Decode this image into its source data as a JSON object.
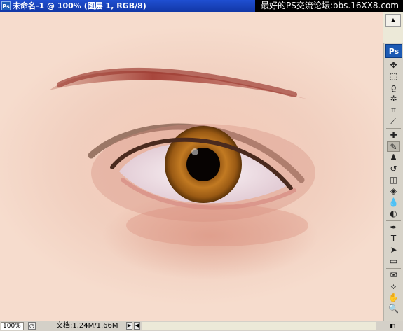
{
  "window": {
    "app_icon_label": "Ps",
    "title": "未命名-1 @ 100% (图层 1, RGB/8)",
    "watermark": "最好的PS交流论坛:bbs.16XX8.com"
  },
  "toolbox": {
    "logo": "Ps",
    "tools": [
      {
        "name": "move-tool",
        "glyph": "✥"
      },
      {
        "name": "marquee-tool",
        "glyph": "⬚"
      },
      {
        "name": "lasso-tool",
        "glyph": "ϱ"
      },
      {
        "name": "magic-wand-tool",
        "glyph": "✲"
      },
      {
        "name": "crop-tool",
        "glyph": "⌗"
      },
      {
        "name": "slice-tool",
        "glyph": "⟋"
      },
      {
        "name": "healing-brush-tool",
        "glyph": "✚"
      },
      {
        "name": "brush-tool",
        "glyph": "✎"
      },
      {
        "name": "clone-stamp-tool",
        "glyph": "♟"
      },
      {
        "name": "history-brush-tool",
        "glyph": "↺"
      },
      {
        "name": "eraser-tool",
        "glyph": "◫"
      },
      {
        "name": "paint-bucket-tool",
        "glyph": "◈"
      },
      {
        "name": "blur-tool",
        "glyph": "💧"
      },
      {
        "name": "dodge-tool",
        "glyph": "◐"
      },
      {
        "name": "pen-tool",
        "glyph": "✒"
      },
      {
        "name": "type-tool",
        "glyph": "T"
      },
      {
        "name": "path-selection-tool",
        "glyph": "➤"
      },
      {
        "name": "shape-tool",
        "glyph": "▭"
      },
      {
        "name": "notes-tool",
        "glyph": "✉"
      },
      {
        "name": "eyedropper-tool",
        "glyph": "⟡"
      },
      {
        "name": "hand-tool",
        "glyph": "✋"
      },
      {
        "name": "zoom-tool",
        "glyph": "🔍"
      }
    ]
  },
  "status": {
    "zoom": "100%",
    "doc_info": "文档:1.24M/1.66M"
  },
  "colors": {
    "skin": "#f3cdbb",
    "iris": "#9a5a14",
    "titlebar": "#1f4fd1"
  }
}
